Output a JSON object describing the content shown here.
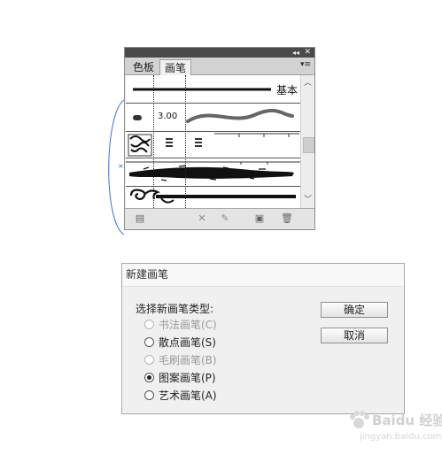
{
  "brush_panel": {
    "tabs": [
      {
        "label": "色板",
        "active": false
      },
      {
        "label": "画笔",
        "active": true
      }
    ],
    "basic_label": "基本",
    "calligraphic_size": "3.00",
    "icons": {
      "collapse": "double-chevron-left-icon",
      "close": "close-icon",
      "menu": "panel-menu-icon",
      "library": "brush-library-icon",
      "remove_stroke": "remove-brush-stroke-icon",
      "options": "brush-options-icon",
      "new": "new-brush-icon",
      "delete": "trash-icon"
    }
  },
  "dialog": {
    "title": "新建画笔",
    "prompt": "选择新画笔类型:",
    "options": [
      {
        "label": "书法画笔(C)",
        "enabled": false,
        "selected": false
      },
      {
        "label": "散点画笔(S)",
        "enabled": true,
        "selected": false
      },
      {
        "label": "毛刷画笔(B)",
        "enabled": false,
        "selected": false
      },
      {
        "label": "图案画笔(P)",
        "enabled": true,
        "selected": true
      },
      {
        "label": "艺术画笔(A)",
        "enabled": true,
        "selected": false
      }
    ],
    "ok_label": "确定",
    "cancel_label": "取消"
  },
  "watermark": {
    "text": "Baidu 经验",
    "sub": "jingyan.baidu.com"
  },
  "colors": {
    "titlebar": "#4a4a4a",
    "selection_arc": "#3a6fd8"
  }
}
